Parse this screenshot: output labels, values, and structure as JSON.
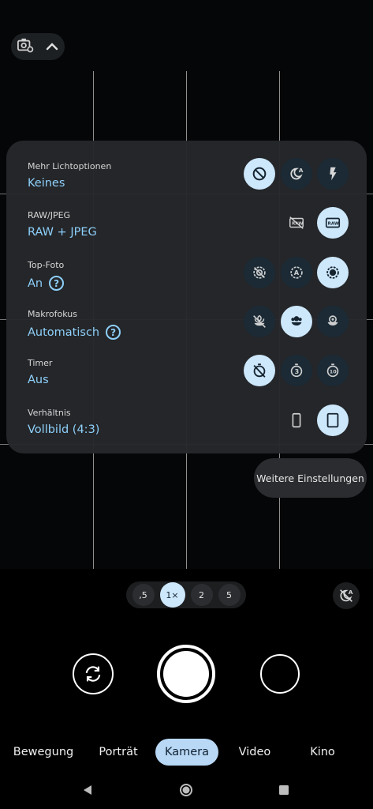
{
  "settings": [
    {
      "label": "Mehr Lichtoptionen",
      "value": "Keines",
      "help": false
    },
    {
      "label": "RAW/JPEG",
      "value": "RAW + JPEG",
      "help": false
    },
    {
      "label": "Top-Foto",
      "value": "An",
      "help": true
    },
    {
      "label": "Makrofokus",
      "value": "Automatisch",
      "help": true
    },
    {
      "label": "Timer",
      "value": "Aus",
      "help": false
    },
    {
      "label": "Verhältnis",
      "value": "Vollbild (4:3)",
      "help": false
    }
  ],
  "more_settings_label": "Weitere Einstellungen",
  "zoom": {
    "options": [
      ",5",
      "1×",
      "2",
      "5"
    ],
    "selected": "1×"
  },
  "modes": {
    "items": [
      "Bewegung",
      "Porträt",
      "Kamera",
      "Video",
      "Kino"
    ],
    "selected": "Kamera"
  },
  "icons": {
    "top_chip": [
      "camera-settings-icon",
      "chevron-up-icon"
    ],
    "light": [
      "off-icon",
      "night-auto-icon",
      "flash-icon"
    ],
    "raw": [
      "jpeg-only-icon",
      "raw-icon"
    ],
    "top_shot": [
      "top-shot-off-icon",
      "top-shot-auto-icon",
      "top-shot-on-icon"
    ],
    "macro": [
      "macro-off-icon",
      "macro-auto-icon",
      "macro-on-icon"
    ],
    "timer": [
      "timer-off-icon",
      "timer-3s-icon",
      "timer-10s-icon"
    ],
    "ratio": [
      "ratio-16-9-icon",
      "ratio-4-3-icon"
    ],
    "bottom": [
      "auto-night-off-icon",
      "switch-camera-icon"
    ]
  },
  "icon_text": {
    "night_a": "A",
    "raw": "RAW",
    "timer_3": "3",
    "timer_10": "10",
    "topshot_a": "A",
    "auto_night_a": "A"
  },
  "colors": {
    "accent": "#8ed0fb",
    "selected_bg": "#cde7fb",
    "panel": "#25272a"
  }
}
